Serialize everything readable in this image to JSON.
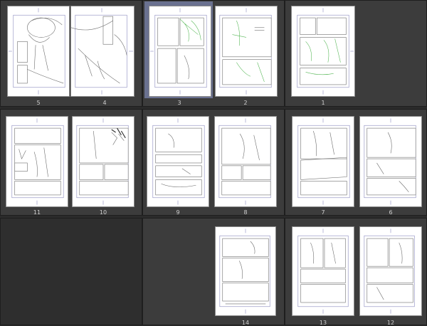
{
  "rows": [
    {
      "spreads": [
        {
          "id": "s-5-4",
          "pages": [
            {
              "number": "5",
              "sketch": "a"
            },
            {
              "number": "4",
              "sketch": "b"
            }
          ]
        },
        {
          "id": "s-3-2",
          "pages": [
            {
              "number": "3",
              "sketch": "c",
              "selected": true
            },
            {
              "number": "2",
              "sketch": "d"
            }
          ]
        },
        {
          "id": "s-1",
          "pages": [
            {
              "number": "1",
              "sketch": "e"
            }
          ]
        }
      ]
    },
    {
      "spreads": [
        {
          "id": "s-11-10",
          "pages": [
            {
              "number": "11",
              "sketch": "f"
            },
            {
              "number": "10",
              "sketch": "g"
            }
          ]
        },
        {
          "id": "s-9-8",
          "pages": [
            {
              "number": "9",
              "sketch": "h"
            },
            {
              "number": "8",
              "sketch": "i"
            }
          ]
        },
        {
          "id": "s-7-6",
          "pages": [
            {
              "number": "7",
              "sketch": "j"
            },
            {
              "number": "6",
              "sketch": "k"
            }
          ]
        }
      ]
    },
    {
      "spreads": [
        {
          "id": "s-14",
          "pages": [
            {
              "number": "14",
              "sketch": "l"
            }
          ]
        },
        {
          "id": "s-13-12",
          "pages": [
            {
              "number": "13",
              "sketch": "m"
            },
            {
              "number": "12",
              "sketch": "n"
            }
          ]
        }
      ]
    }
  ],
  "colors": {
    "background": "#2b2b2b",
    "spread": "#3c3c3c",
    "selection": "#6a7190",
    "guide": "#7070b0",
    "sketch": "#6a6a6a",
    "sketch_green": "#58b858"
  }
}
